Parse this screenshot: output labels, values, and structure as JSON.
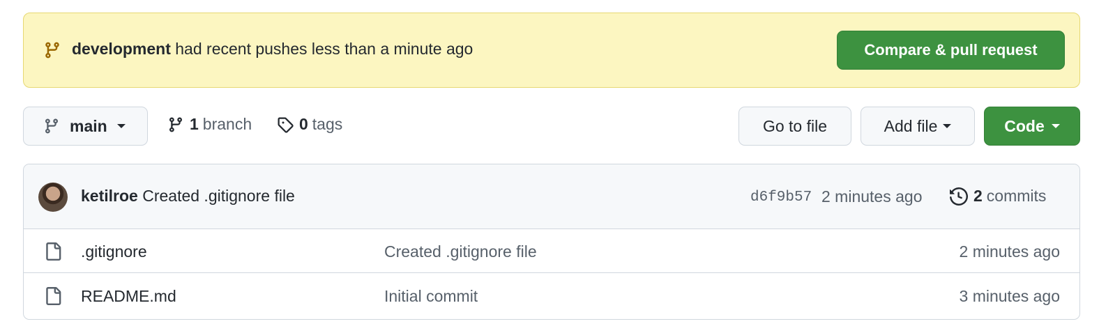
{
  "banner": {
    "branch": "development",
    "message": "had recent pushes less than a minute ago",
    "compare_button": "Compare & pull request"
  },
  "toolbar": {
    "branch_select": "main",
    "branch_count": "1",
    "branch_word": "branch",
    "tag_count": "0",
    "tag_word": "tags",
    "goto_file": "Go to file",
    "add_file": "Add file",
    "code": "Code"
  },
  "latest_commit": {
    "author": "ketilroe",
    "message": "Created .gitignore file",
    "sha": "d6f9b57",
    "time": "2 minutes ago",
    "commit_count": "2",
    "commit_word": "commits"
  },
  "files": [
    {
      "name": ".gitignore",
      "message": "Created .gitignore file",
      "time": "2 minutes ago"
    },
    {
      "name": "README.md",
      "message": "Initial commit",
      "time": "3 minutes ago"
    }
  ],
  "colors": {
    "banner_bg": "#fcf6c1",
    "green": "#3d9240",
    "border": "#d0d7de",
    "muted": "#57606a"
  }
}
